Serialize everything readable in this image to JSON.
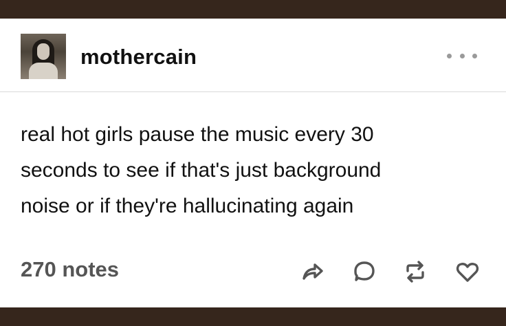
{
  "post": {
    "username": "mothercain",
    "text_lines": [
      "real hot girls pause the music every 30",
      "seconds to see if that's just background",
      "noise or if they're hallucinating again"
    ],
    "notes": "270 notes"
  },
  "icons": {
    "more": "more-options-icon",
    "share": "share-icon",
    "reply": "reply-icon",
    "reblog": "reblog-icon",
    "like": "heart-icon"
  },
  "colors": {
    "frame": "#36261c",
    "card": "#ffffff",
    "text": "#111111",
    "muted": "#555555",
    "icon": "#555555"
  }
}
